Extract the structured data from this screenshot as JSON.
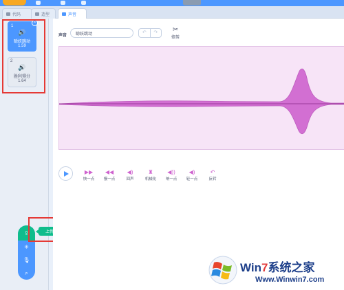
{
  "tabs": [
    {
      "label": "代码"
    },
    {
      "label": "造型"
    },
    {
      "label": "声音"
    }
  ],
  "sounds": [
    {
      "index": "1",
      "name": "聪妖跳动",
      "duration": "1.59",
      "selected": true
    },
    {
      "index": "2",
      "name": "胜利得分",
      "duration": "1.64",
      "selected": false
    }
  ],
  "editor": {
    "sound_label": "声音",
    "sound_name": "聪妖跳动",
    "trim_label": "修剪"
  },
  "effects": [
    {
      "label": "快一点",
      "icon": "fast-icon"
    },
    {
      "label": "慢一点",
      "icon": "slow-icon"
    },
    {
      "label": "回声",
      "icon": "echo-icon"
    },
    {
      "label": "机械化",
      "icon": "robot-icon"
    },
    {
      "label": "响一点",
      "icon": "louder-icon"
    },
    {
      "label": "轻一点",
      "icon": "softer-icon"
    },
    {
      "label": "反转",
      "icon": "reverse-icon"
    }
  ],
  "upload_tooltip": "上传声音",
  "watermark": {
    "title_prefix": "Win",
    "title_seven": "7",
    "title_suffix": "系统之家",
    "url": "Www.Winwin7.com"
  },
  "colors": {
    "accent": "#4c97ff",
    "wave": "#cf63cf",
    "upload": "#0fbd8c",
    "highlight": "#e53935"
  }
}
